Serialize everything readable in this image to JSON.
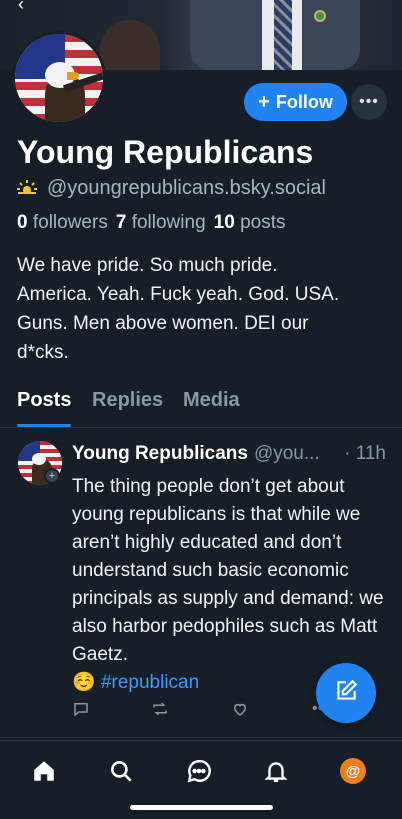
{
  "header": {
    "back_icon": "chevron-left-icon"
  },
  "profile": {
    "display_name": "Young Republicans",
    "handle": "@youngrepublicans.bsky.social",
    "handle_icon": "sun-icon",
    "follow_label": "Follow",
    "more_label": "•••",
    "stats": {
      "followers_count": "0",
      "followers_label": "followers",
      "following_count": "7",
      "following_label": "following",
      "posts_count": "10",
      "posts_label": "posts"
    },
    "bio": "We have pride. So much pride.\nAmerica. Yeah. Fuck yeah. God. USA.\nGuns. Men above women. DEI our\nd*cks."
  },
  "tabs": [
    {
      "label": "Posts",
      "active": true
    },
    {
      "label": "Replies",
      "active": false
    },
    {
      "label": "Media",
      "active": false
    }
  ],
  "post": {
    "author": "Young Republicans",
    "handle": "@you...",
    "time": "· 11h",
    "text": "The thing people don’t get about young republicans is that while we aren’t highly educated and don’t understand such basic economic principals as supply and demand: we also harbor pedophiles such as Matt Gaetz.",
    "emoji": "☺️",
    "hashtag": "#republican",
    "actions": [
      "reply-icon",
      "repost-icon",
      "like-icon",
      "more-icon"
    ]
  },
  "fab": {
    "icon": "compose-icon"
  },
  "bottom_nav": {
    "items": [
      "home-icon",
      "search-icon",
      "chat-icon",
      "notifications-icon",
      "profile-avatar"
    ],
    "avatar_letter": "@"
  },
  "colors": {
    "accent": "#1f84f2",
    "background": "#161e27",
    "muted": "#8b97a5",
    "avatar_orange": "#f07d1a"
  }
}
